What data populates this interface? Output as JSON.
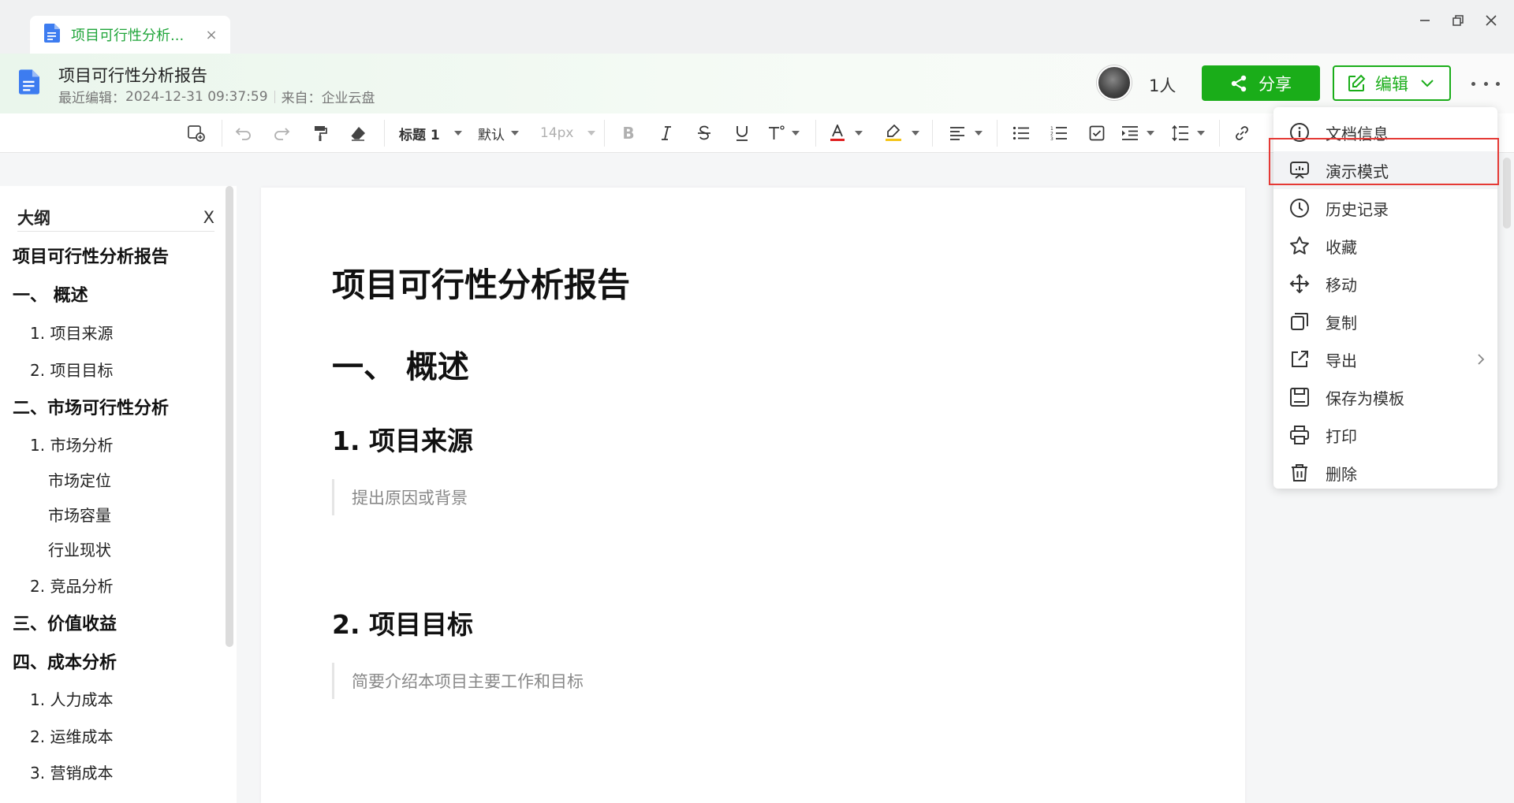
{
  "tab": {
    "title": "项目可行性分析...",
    "close": "×"
  },
  "header": {
    "title": "项目可行性分析报告",
    "last_edit_label": "最近编辑：",
    "last_edit_time": "2024-12-31 09:37:59",
    "source_label": "来自：",
    "source": "企业云盘",
    "people_count": "1人",
    "share_label": "分享",
    "edit_label": "编辑"
  },
  "toolbar": {
    "heading_style": "标题 1",
    "font": "默认",
    "font_size": "14px",
    "font_color": "#e02020",
    "highlight_color": "#f5c518"
  },
  "outline": {
    "title": "大纲",
    "close": "X",
    "items": [
      {
        "label": "项目可行性分析报告",
        "level": 1
      },
      {
        "label": "一、 概述",
        "level": 1
      },
      {
        "label": "1. 项目来源",
        "level": 2
      },
      {
        "label": "2. 项目目标",
        "level": 2
      },
      {
        "label": "二、市场可行性分析",
        "level": 1
      },
      {
        "label": "1. 市场分析",
        "level": 2
      },
      {
        "label": "市场定位",
        "level": 3
      },
      {
        "label": "市场容量",
        "level": 3
      },
      {
        "label": "行业现状",
        "level": 3
      },
      {
        "label": "2. 竞品分析",
        "level": 2
      },
      {
        "label": "三、价值收益",
        "level": 1
      },
      {
        "label": "四、成本分析",
        "level": 1
      },
      {
        "label": "1. 人力成本",
        "level": 2
      },
      {
        "label": "2. 运维成本",
        "level": 2
      },
      {
        "label": "3. 营销成本",
        "level": 2
      }
    ]
  },
  "document": {
    "title": "项目可行性分析报告",
    "h1": "一、 概述",
    "section1_title": "1. 项目来源",
    "section1_quote": "提出原因或背景",
    "section2_title": "2. 项目目标",
    "section2_quote": "简要介绍本项目主要工作和目标"
  },
  "menu": {
    "items": [
      {
        "label": "文档信息",
        "icon": "info-icon"
      },
      {
        "label": "演示模式",
        "icon": "presentation-icon"
      },
      {
        "label": "历史记录",
        "icon": "clock-icon"
      },
      {
        "label": "收藏",
        "icon": "star-icon"
      },
      {
        "label": "移动",
        "icon": "move-icon"
      },
      {
        "label": "复制",
        "icon": "copy-icon"
      },
      {
        "label": "导出",
        "icon": "export-icon"
      },
      {
        "label": "保存为模板",
        "icon": "save-template-icon"
      },
      {
        "label": "打印",
        "icon": "print-icon"
      },
      {
        "label": "删除",
        "icon": "trash-icon"
      }
    ],
    "highlighted": "演示模式"
  },
  "colors": {
    "accent": "#1aad19",
    "highlight_border": "#e53935"
  }
}
